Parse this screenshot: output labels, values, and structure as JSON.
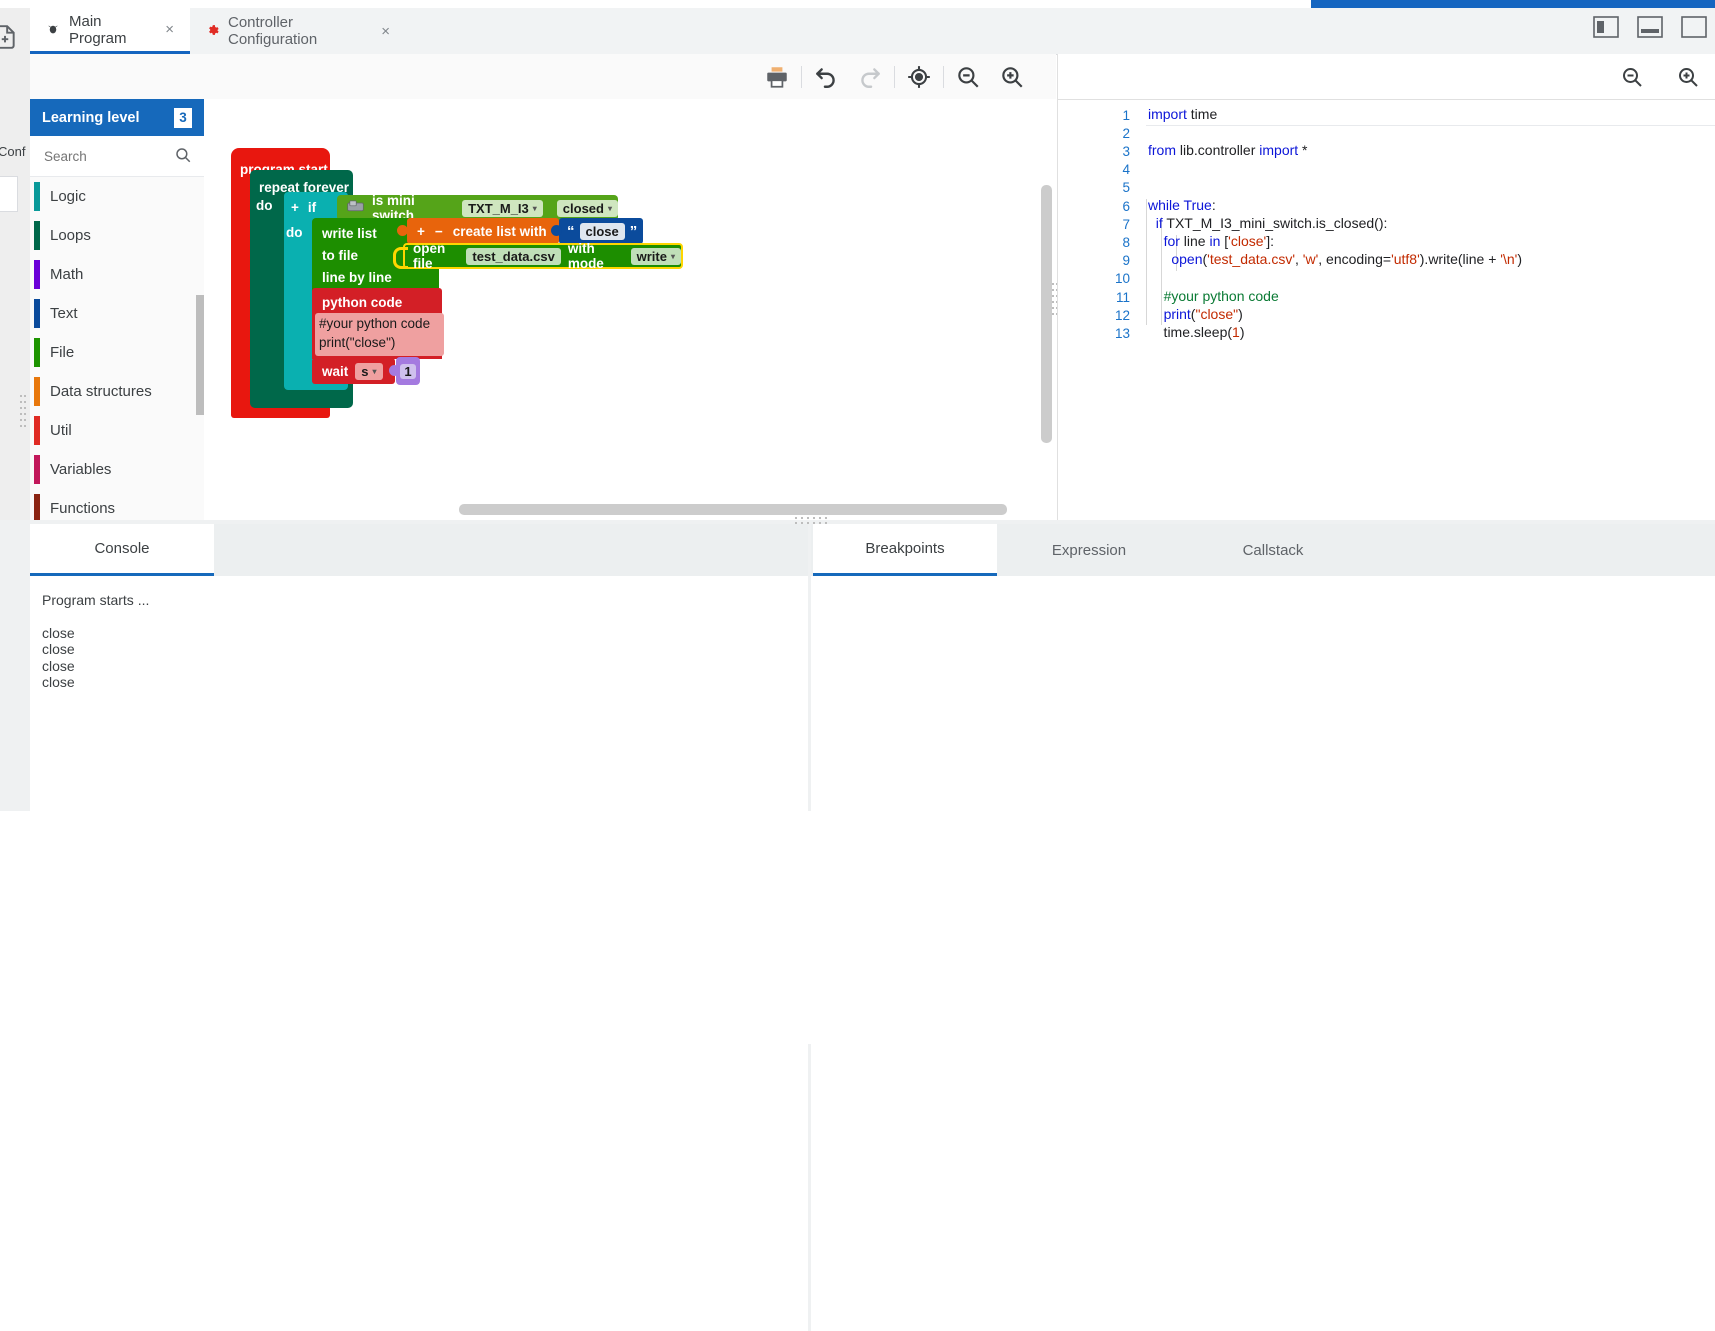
{
  "window": {
    "rail": {
      "new_file_icon": "new-file-icon",
      "conf_label": "Conf"
    },
    "controls": [
      {
        "name": "sidebar-toggle-icon",
        "label": ""
      },
      {
        "name": "minimize-icon",
        "label": ""
      },
      {
        "name": "maximize-icon",
        "label": ""
      }
    ]
  },
  "tabs": [
    {
      "label": "Main Program",
      "icon": "bug-icon",
      "close": "×",
      "active": true
    },
    {
      "label": "Controller Configuration",
      "icon": "gear-icon",
      "close": "×",
      "active": false
    }
  ],
  "toolbar": {
    "buttons": [
      {
        "name": "print-button",
        "label": "print"
      },
      {
        "name": "undo-button",
        "label": "undo"
      },
      {
        "name": "redo-button",
        "label": "redo"
      },
      {
        "name": "center-button",
        "label": "center blocks"
      },
      {
        "name": "zoom-out-button",
        "label": "zoom out"
      },
      {
        "name": "zoom-in-button",
        "label": "zoom in"
      }
    ]
  },
  "palette": {
    "title": "Learning level",
    "level": "3",
    "search": {
      "placeholder": "Search",
      "value": "",
      "icon": "search-icon"
    },
    "categories": [
      {
        "label": "Logic",
        "color": "#0a9a9a"
      },
      {
        "label": "Loops",
        "color": "#00684a"
      },
      {
        "label": "Math",
        "color": "#6a00d8"
      },
      {
        "label": "Text",
        "color": "#0b4b9c"
      },
      {
        "label": "File",
        "color": "#1d9400"
      },
      {
        "label": "Data structures",
        "color": "#e8780c"
      },
      {
        "label": "Util",
        "color": "#e02b24"
      },
      {
        "label": "Variables",
        "color": "#c2185b"
      },
      {
        "label": "Functions",
        "color": "#8b2413"
      }
    ]
  },
  "workspace": {
    "blocks": {
      "program_start": "program start",
      "repeat_forever": "repeat forever",
      "do_1": "do",
      "if_plus": "+",
      "if_label": "if",
      "sensor_icon": "mini-switch-icon",
      "is_mini_switch": "is mini switch",
      "switch_port": "TXT_M_I3",
      "switch_state": "closed",
      "do_2": "do",
      "write_list": "write list",
      "to_file": "to file",
      "line_by_line": "line by line",
      "list_plus": "+",
      "list_minus": "−",
      "create_list_with": "create list with",
      "quote_open": "“",
      "text_value": "close",
      "quote_close": "”",
      "open_file": "open file",
      "file_name": "test_data.csv",
      "with_mode": "with mode",
      "mode_value": "write",
      "python_code": "python code",
      "python_body_line1": "#your python code",
      "python_body_line2": "print(\"close\")",
      "wait_label": "wait",
      "wait_unit": "s",
      "wait_value": "1"
    },
    "colors": {
      "start": "#e8170f",
      "loop": "#00684a",
      "logic": "#0ab0b0",
      "sensor": "#55a419",
      "file": "#1d8e00",
      "list": "#e8640c",
      "text": "#0b4b9c",
      "util": "#d31f26",
      "math": "#a47ae0",
      "python_body": "#efa0a0"
    }
  },
  "code_panel": {
    "buttons": [
      {
        "name": "code-zoom-out-button",
        "label": "zoom out"
      },
      {
        "name": "code-zoom-in-button",
        "label": "zoom in"
      }
    ],
    "lines": [
      {
        "n": "1",
        "text": "import time"
      },
      {
        "n": "2",
        "text": ""
      },
      {
        "n": "3",
        "text": "from lib.controller import *"
      },
      {
        "n": "4",
        "text": ""
      },
      {
        "n": "5",
        "text": ""
      },
      {
        "n": "6",
        "text": "while True:"
      },
      {
        "n": "7",
        "text": "    if TXT_M_I3_mini_switch.is_closed():"
      },
      {
        "n": "8",
        "text": "        for line in ['close']:"
      },
      {
        "n": "9",
        "text": "            open('test_data.csv', 'w', encoding='utf8').write(line + '\\n')"
      },
      {
        "n": "10",
        "text": "        #your python code"
      },
      {
        "n": "11",
        "text": "        print(\"close\")"
      },
      {
        "n": "12",
        "text": "        time.sleep(1)"
      },
      {
        "n": "13",
        "text": ""
      }
    ]
  },
  "bottom": {
    "left_tabs": [
      {
        "label": "Console",
        "active": true
      }
    ],
    "right_tabs": [
      {
        "label": "Breakpoints",
        "active": true
      },
      {
        "label": "Expression",
        "active": false
      },
      {
        "label": "Callstack",
        "active": false
      }
    ],
    "console_output": [
      "Program starts ...",
      "",
      "close",
      "close",
      "close",
      "close"
    ]
  }
}
